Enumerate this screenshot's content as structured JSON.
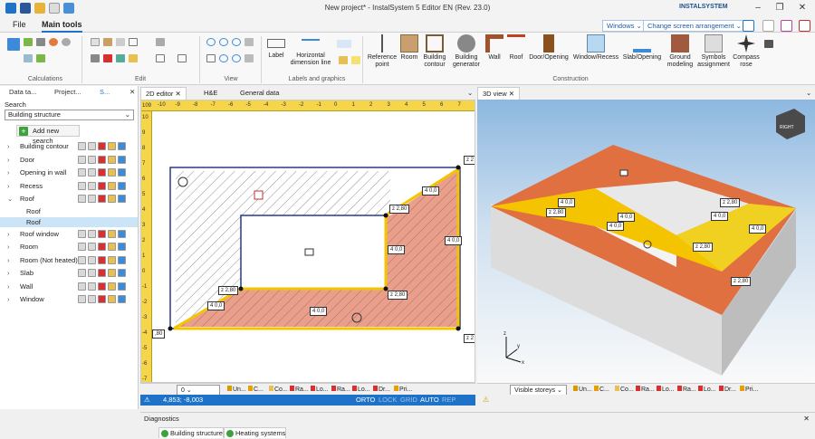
{
  "window": {
    "title": "New project* - InstalSystem 5 Editor EN (Rev. 23.0)",
    "brand": "INSTALSYSTEM"
  },
  "menu": {
    "file": "File",
    "main_tools": "Main tools",
    "windows": "Windows",
    "screen_arrangement": "Change screen arrangement"
  },
  "ribbon": {
    "groups": {
      "calculations": "Calculations",
      "edit": "Edit",
      "view": "View",
      "labels": "Labels and graphics",
      "construction": "Construction"
    },
    "tools": {
      "label": "Label",
      "horiz_dim": "Horizontal dimension line",
      "ref_point": "Reference point",
      "room": "Room",
      "building_contour": "Building contour",
      "building_generator": "Building generator",
      "wall": "Wall",
      "roof": "Roof",
      "door_opening": "Door/Opening",
      "window_recess": "Window/Recess",
      "slab_opening": "Slab/Opening",
      "ground_modeling": "Ground modeling",
      "symbols_assignment": "Symbols assignment",
      "compass_rose": "Compass rose"
    }
  },
  "left_panel": {
    "tabs": [
      "Data ta...",
      "Project...",
      "S..."
    ],
    "search_label": "Search",
    "search_value": "Building structure",
    "add_search": "Add new search",
    "tree": [
      "Building contour",
      "Door",
      "Opening in wall",
      "Recess",
      "Roof",
      "Roof window",
      "Room",
      "Room (Not heated)",
      "Slab",
      "Wall",
      "Window"
    ],
    "roof_children": [
      "Roof",
      "Roof"
    ]
  },
  "editor_tabs": {
    "editor": "2D editor",
    "he": "H&E",
    "general": "General data"
  },
  "editor": {
    "ruler_top": [
      "-10",
      "-9",
      "-8",
      "-7",
      "-6",
      "-5",
      "-4",
      "-3",
      "-2",
      "-1",
      "0",
      "1",
      "2",
      "3",
      "4",
      "5",
      "6",
      "7"
    ],
    "ruler_left": [
      "10",
      "9",
      "8",
      "7",
      "6",
      "5",
      "4",
      "3",
      "2",
      "1",
      "0",
      "-1",
      "-2",
      "-3",
      "-4",
      "-5",
      "-6",
      "-7"
    ],
    "scale": "109",
    "labels": [
      "z 2",
      "4 0,0",
      "z 2,80",
      "4 0,0",
      "4 0,0",
      "z 2,80",
      "4 0,0",
      "z 2,80",
      "4 0,0",
      "z 2",
      ",80"
    ]
  },
  "editor_bottom": {
    "storey": "0",
    "layers": [
      "Un...",
      "C...",
      "Co...",
      "Ra...",
      "Lo...",
      "Ra...",
      "Lo...",
      "Dr...",
      "Pri..."
    ]
  },
  "status": {
    "coords": "4,853; -8,003",
    "orto": "ORTO",
    "lock": "LOCK",
    "grid": "GRID",
    "auto": "AUTO",
    "rep": "REP"
  },
  "view3d": {
    "tab": "3D view",
    "visible_storeys": "Visible storeys",
    "labels": [
      "4 0,0",
      "z 2,80",
      "4 0,0",
      "4 0,0",
      "z 2,80",
      "4 0,0",
      "4 0,0",
      "z 2,80",
      "z 2,80"
    ],
    "axes": {
      "x": "x",
      "y": "y",
      "z": "z"
    },
    "cube_label": "RIGHT"
  },
  "bottom_panel": {
    "title": "Diagnostics",
    "tabs": [
      "Building structure",
      "Heating systems"
    ]
  },
  "colors": {
    "accent": "#1e73c8",
    "ruler": "#f5d54a",
    "roof_fill": "#e8a08c",
    "yellow": "#f5c400",
    "orange_roof": "#e07040"
  }
}
